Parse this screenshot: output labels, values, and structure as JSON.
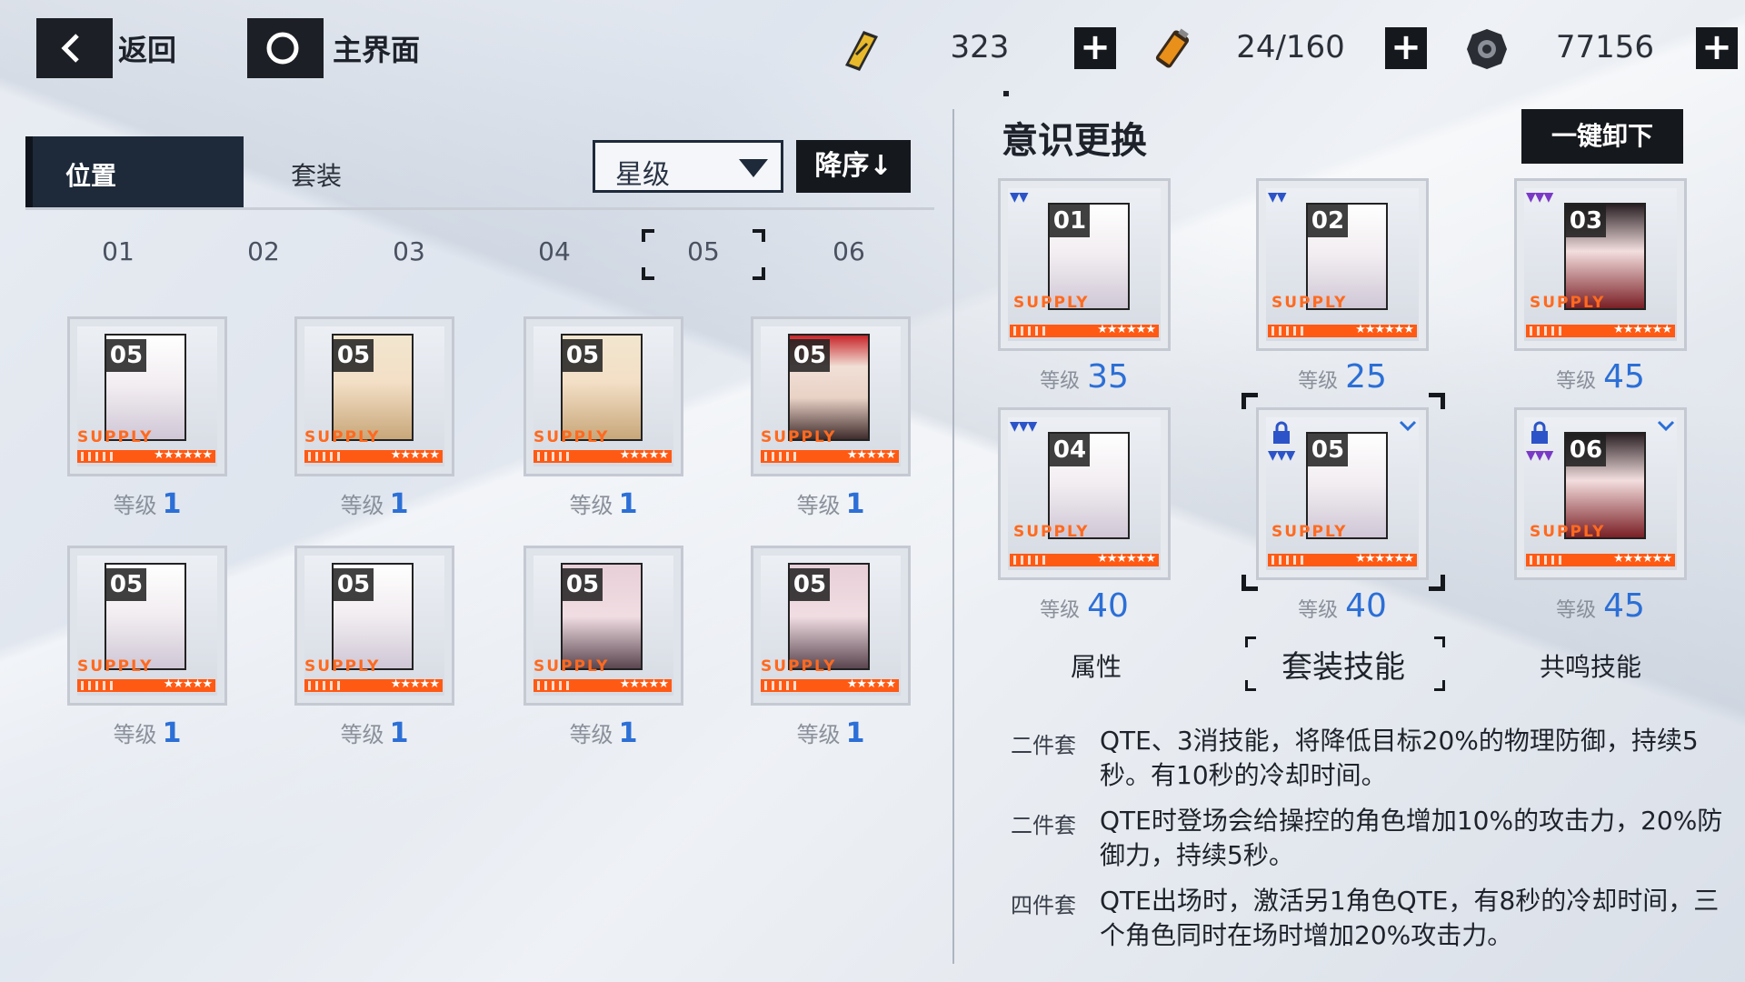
{
  "topbar": {
    "back_label": "返回",
    "home_label": "主界面",
    "resources": [
      {
        "icon": "gold-ticket-icon",
        "value": "323"
      },
      {
        "icon": "energy-battery-icon",
        "value": "24/160"
      },
      {
        "icon": "gear-coin-icon",
        "value": "77156"
      }
    ]
  },
  "left": {
    "tabs": [
      "位置",
      "套装"
    ],
    "sort_select": "星级",
    "sort_order": "降序↓",
    "positions": [
      "01",
      "02",
      "03",
      "04",
      "05",
      "06"
    ],
    "selected_position": "05",
    "level_label": "等级",
    "inventory": [
      {
        "num": "05",
        "supply": "SUPPLY",
        "stars": "★★★★★★",
        "level": "1",
        "style": "p-white"
      },
      {
        "num": "05",
        "supply": "SUPPLY",
        "stars": "★★★★★",
        "level": "1",
        "style": "p-blonde"
      },
      {
        "num": "05",
        "supply": "SUPPLY",
        "stars": "★★★★★",
        "level": "1",
        "style": "p-blonde"
      },
      {
        "num": "05",
        "supply": "SUPPLY",
        "stars": "★★★★★",
        "level": "1",
        "style": "p-red"
      },
      {
        "num": "05",
        "supply": "SUPPLY",
        "stars": "★★★★★",
        "level": "1",
        "style": "p-white"
      },
      {
        "num": "05",
        "supply": "SUPPLY",
        "stars": "★★★★★",
        "level": "1",
        "style": "p-white"
      },
      {
        "num": "05",
        "supply": "SUPPLY",
        "stars": "★★★★★",
        "level": "1",
        "style": "p-pink"
      },
      {
        "num": "05",
        "supply": "SUPPLY",
        "stars": "★★★★★",
        "level": "1",
        "style": "p-pink"
      }
    ]
  },
  "right": {
    "title": "意识更换",
    "unequip_label": "一键卸下",
    "level_label": "等级",
    "equipped": [
      {
        "num": "01",
        "supply": "SUPPLY",
        "stars": "★★★★★★",
        "level": "35",
        "tier": "▼▼",
        "tier_color": "blue",
        "style": "p-white",
        "locked": false,
        "checked": false
      },
      {
        "num": "02",
        "supply": "SUPPLY",
        "stars": "★★★★★★",
        "level": "25",
        "tier": "▼▼",
        "tier_color": "blue",
        "style": "p-white",
        "locked": false,
        "checked": false
      },
      {
        "num": "03",
        "supply": "SUPPLY",
        "stars": "★★★★★★",
        "level": "45",
        "tier": "▼▼▼",
        "tier_color": "purple",
        "style": "p-dark",
        "locked": false,
        "checked": false
      },
      {
        "num": "04",
        "supply": "SUPPLY",
        "stars": "★★★★★★",
        "level": "40",
        "tier": "▼▼▼",
        "tier_color": "blue",
        "style": "p-white",
        "locked": false,
        "checked": false
      },
      {
        "num": "05",
        "supply": "SUPPLY",
        "stars": "★★★★★★",
        "level": "40",
        "tier": "▼▼▼",
        "tier_color": "blue",
        "style": "p-white",
        "locked": true,
        "checked": true
      },
      {
        "num": "06",
        "supply": "SUPPLY",
        "stars": "★★★★★★",
        "level": "45",
        "tier": "▼▼▼",
        "tier_color": "purple",
        "style": "p-dark",
        "locked": true,
        "checked": true
      }
    ],
    "subtabs": [
      "属性",
      "套装技能",
      "共鸣技能"
    ],
    "active_subtab": "套装技能",
    "skills": [
      {
        "tag": "二件套",
        "text": "QTE、3消技能，将降低目标20%的物理防御，持续5秒。有10秒的冷却时间。"
      },
      {
        "tag": "二件套",
        "text": "QTE时登场会给操控的角色增加10%的攻击力，20%防御力，持续5秒。"
      },
      {
        "tag": "四件套",
        "text": "QTE出场时，激活另1角色QTE，有8秒的冷却时间，三个角色同时在场时增加20%攻击力。"
      }
    ]
  },
  "colors": {
    "accent_blue": "#2c6fd6",
    "rarity_orange": "#ff5a14",
    "dark": "#15181d"
  }
}
